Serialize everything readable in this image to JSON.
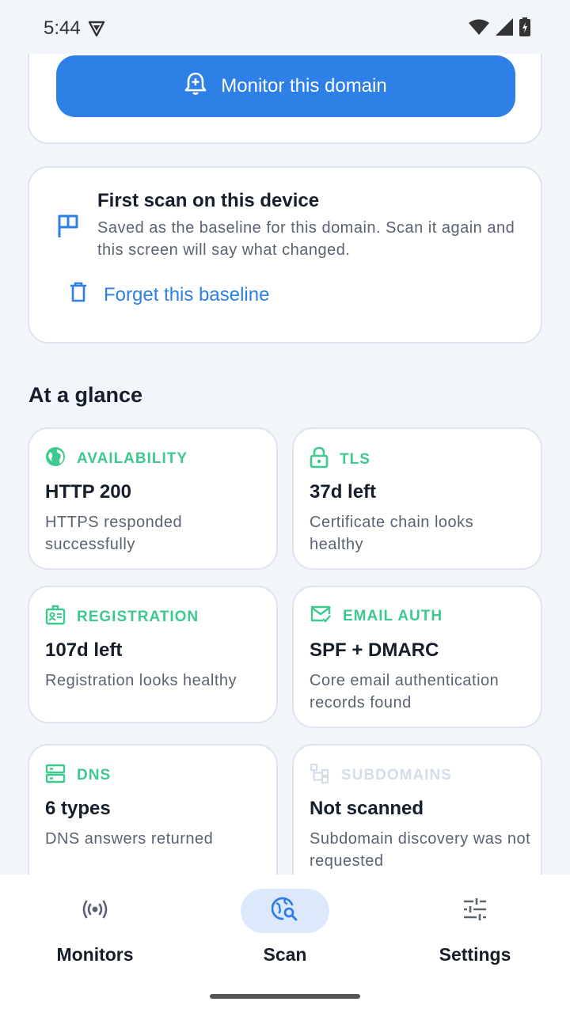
{
  "status_bar": {
    "time": "5:44"
  },
  "monitor_card": {
    "button_label": "Monitor this domain"
  },
  "baseline_card": {
    "title": "First scan on this device",
    "description": "Saved as the baseline for this domain. Scan it again and this screen will say what changed.",
    "forget_label": "Forget this baseline"
  },
  "glance": {
    "title": "At a glance",
    "tiles": [
      {
        "label": "AVAILABILITY",
        "value": "HTTP 200",
        "desc": "HTTPS responded successfully",
        "icon": "globe-icon"
      },
      {
        "label": "TLS",
        "value": "37d left",
        "desc": "Certificate chain looks healthy",
        "icon": "lock-icon"
      },
      {
        "label": "REGISTRATION",
        "value": "107d left",
        "desc": "Registration looks healthy",
        "icon": "id-badge-icon"
      },
      {
        "label": "EMAIL AUTH",
        "value": "SPF + DMARC",
        "desc": "Core email authentication records found",
        "icon": "mail-check-icon"
      },
      {
        "label": "DNS",
        "value": "6 types",
        "desc": "DNS answers returned",
        "icon": "dns-icon"
      },
      {
        "label": "SUBDOMAINS",
        "value": "Not scanned",
        "desc": "Subdomain discovery was not requested",
        "icon": "sitemap-icon"
      }
    ]
  },
  "nav": {
    "items": [
      {
        "label": "Monitors",
        "icon": "broadcast-icon"
      },
      {
        "label": "Scan",
        "icon": "scan-search-icon"
      },
      {
        "label": "Settings",
        "icon": "sliders-icon"
      }
    ],
    "active": "Scan"
  },
  "colors": {
    "accent": "#2e7fe6",
    "success": "#3ec98e",
    "muted": "#d5dde8",
    "background": "#f2f5fa"
  }
}
